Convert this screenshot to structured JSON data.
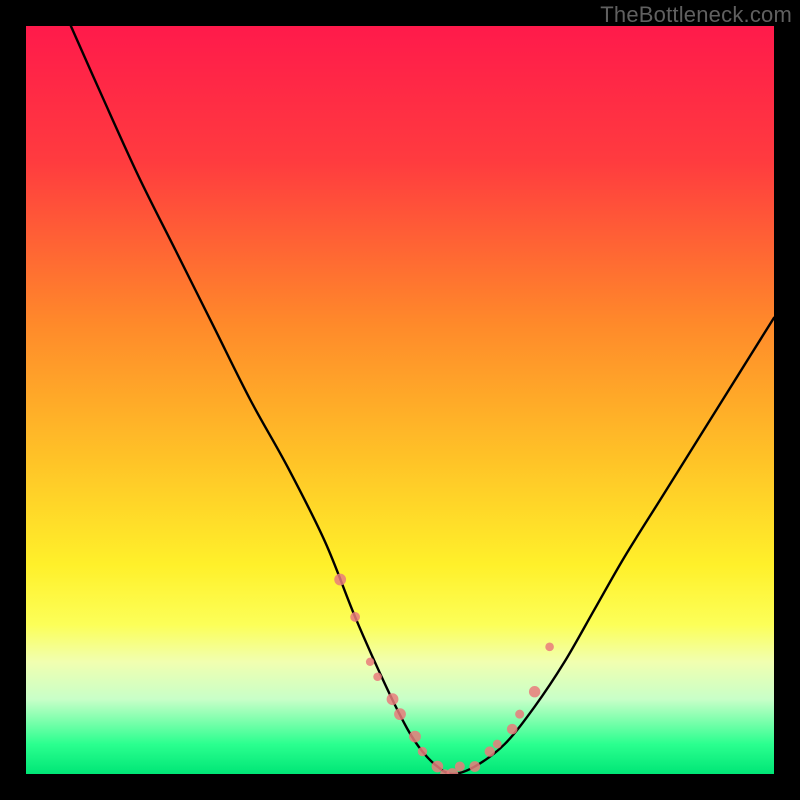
{
  "watermark": "TheBottleneck.com",
  "chart_data": {
    "type": "line",
    "title": "",
    "xlabel": "",
    "ylabel": "",
    "xlim": [
      0,
      100
    ],
    "ylim": [
      0,
      100
    ],
    "gradient_stops": [
      {
        "offset": 0,
        "color": "#ff1a4b"
      },
      {
        "offset": 18,
        "color": "#ff3b3f"
      },
      {
        "offset": 40,
        "color": "#ff8a2a"
      },
      {
        "offset": 58,
        "color": "#ffc327"
      },
      {
        "offset": 72,
        "color": "#fff02a"
      },
      {
        "offset": 80,
        "color": "#fcff58"
      },
      {
        "offset": 85,
        "color": "#f1ffb0"
      },
      {
        "offset": 90,
        "color": "#c8ffc8"
      },
      {
        "offset": 96,
        "color": "#2bff8f"
      },
      {
        "offset": 100,
        "color": "#00e676"
      }
    ],
    "series": [
      {
        "name": "bottleneck-curve",
        "note": "y = bottleneck percentage (0 at optimum, 100 at worst). Plot draws (x, 100 - y) so optimum is at bottom.",
        "x": [
          6,
          10,
          15,
          20,
          25,
          30,
          35,
          40,
          44,
          48,
          51,
          53,
          55,
          57,
          60,
          64,
          68,
          72,
          76,
          80,
          85,
          90,
          95,
          100
        ],
        "y": [
          100,
          91,
          80,
          70,
          60,
          50,
          41,
          31,
          21,
          12,
          6,
          3,
          1,
          0,
          1,
          4,
          9,
          15,
          22,
          29,
          37,
          45,
          53,
          61
        ]
      }
    ],
    "markers": {
      "name": "highlight-dots",
      "x": [
        42,
        44,
        46,
        47,
        49,
        50,
        52,
        53,
        55,
        56,
        57,
        58,
        60,
        62,
        63,
        65,
        66,
        68,
        70
      ],
      "y": [
        26,
        21,
        15,
        13,
        10,
        8,
        5,
        3,
        1,
        0,
        0,
        1,
        1,
        3,
        4,
        6,
        8,
        11,
        17
      ]
    }
  }
}
